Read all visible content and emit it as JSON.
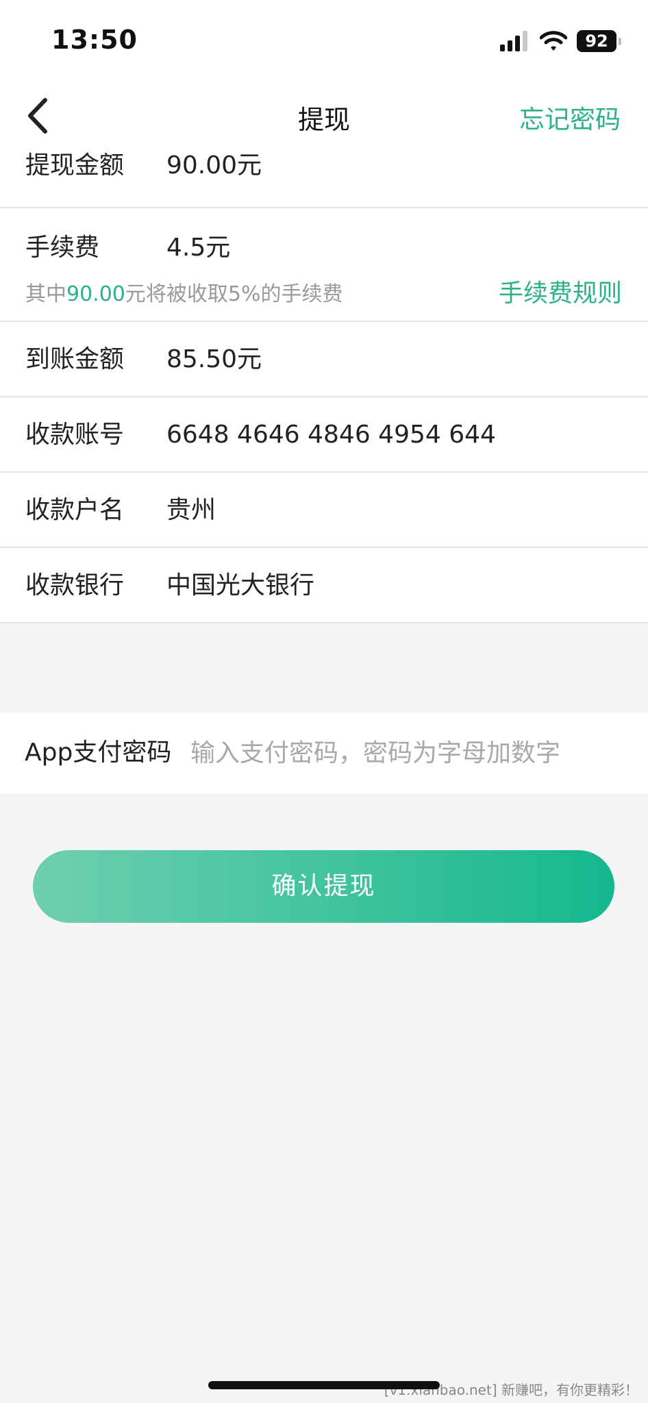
{
  "status_bar": {
    "time": "13:50",
    "battery": "92"
  },
  "nav": {
    "title": "提现",
    "forgot_password": "忘记密码"
  },
  "rows": [
    {
      "label": "提现金额",
      "value": "90.00元"
    },
    {
      "label": "到账金额",
      "value": "85.50元"
    },
    {
      "label": "收款账号",
      "value": "6648 4646 4846 4954 644"
    },
    {
      "label": "收款户名",
      "value": "贵州"
    },
    {
      "label": "收款银行",
      "value": "中国光大银行"
    }
  ],
  "fee": {
    "label": "手续费",
    "value": "4.5元",
    "note_prefix": "其中",
    "note_amount": "90.00",
    "note_suffix": "元将被收取5%的手续费",
    "rule_link": "手续费规则"
  },
  "password": {
    "label": "App支付密码",
    "placeholder": "输入支付密码，密码为字母加数字"
  },
  "confirm_button": "确认提现",
  "watermark": "[v1.xianbao.net] 新赚吧，有你更精彩！",
  "colors": {
    "accent": "#2bb287",
    "button_gradient_start": "#6ecfb0",
    "button_gradient_end": "#14b88e"
  }
}
